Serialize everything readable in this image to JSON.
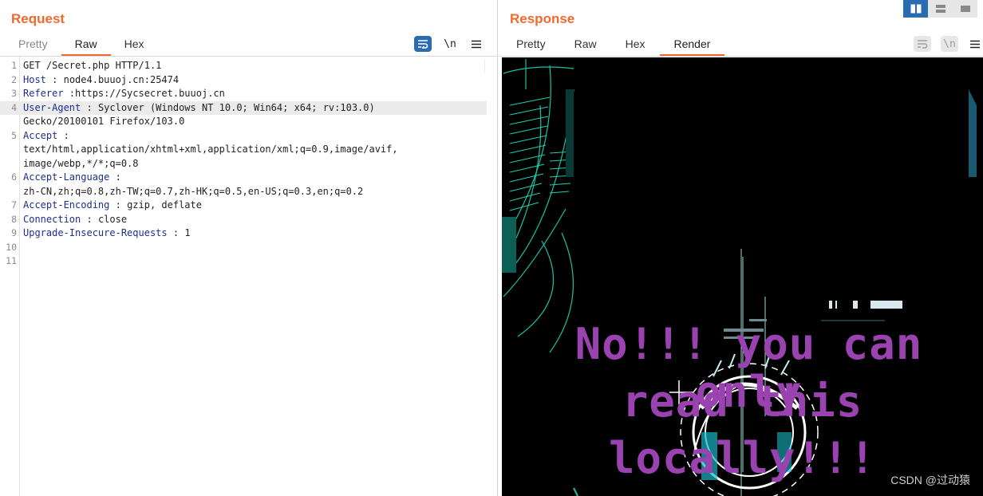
{
  "request": {
    "title": "Request",
    "tabs": [
      {
        "label": "Pretty"
      },
      {
        "label": "Raw"
      },
      {
        "label": "Hex"
      }
    ],
    "active_tab": "Raw",
    "toolbar": {
      "wrap_icon": "wrap-lines-icon",
      "newline_label": "\\n",
      "menu_icon": "hamburger-menu-icon"
    },
    "lines": [
      {
        "num": "1",
        "text": "GET /Secret.php  HTTP/1.1"
      },
      {
        "num": "2",
        "key": "Host",
        "sep": " : ",
        "val": "node4.buuoj.cn:25474"
      },
      {
        "num": "3",
        "key": "Referer",
        "sep": " :",
        "val": "https://Sycsecret.buuoj.cn"
      },
      {
        "num": "4",
        "key": "User-Agent",
        "sep": " : ",
        "val": "Syclover  (Windows  NT 10.0;  Win64;  x64;  rv:103.0)"
      },
      {
        "num": "",
        "text": "Gecko/20100101   Firefox/103.0"
      },
      {
        "num": "5",
        "key": "Accept",
        "sep": " :",
        "val": ""
      },
      {
        "num": "",
        "text": "text/html,application/xhtml+xml,application/xml;q=0.9,image/avif,"
      },
      {
        "num": "",
        "text": "image/webp,*/*;q=0.8"
      },
      {
        "num": "6",
        "key": "Accept-Language",
        "sep": "  :",
        "val": ""
      },
      {
        "num": "",
        "text": "zh-CN,zh;q=0.8,zh-TW;q=0.7,zh-HK;q=0.5,en-US;q=0.3,en;q=0.2"
      },
      {
        "num": "7",
        "key": "Accept-Encoding",
        "sep": " : ",
        "val": "gzip,  deflate"
      },
      {
        "num": "8",
        "key": "Connection",
        "sep": " : ",
        "val": "close"
      },
      {
        "num": "9",
        "key": "Upgrade-Insecure-Requests",
        "sep": "  : ",
        "val": "1"
      },
      {
        "num": "10",
        "text": ""
      },
      {
        "num": "11",
        "text": ""
      }
    ],
    "highlighted_line": 3
  },
  "response": {
    "title": "Response",
    "tabs": [
      {
        "label": "Pretty"
      },
      {
        "label": "Raw"
      },
      {
        "label": "Hex"
      },
      {
        "label": "Render"
      }
    ],
    "active_tab": "Render",
    "toolbar": {
      "wrap_icon": "wrap-lines-icon",
      "newline_label": "\\n",
      "menu_icon": "hamburger-menu-icon"
    },
    "render": {
      "message_lines": [
        "No!!! you can only",
        "read this",
        "locally!!!"
      ],
      "message_color": "#9a43b0",
      "background_color": "#000000"
    }
  },
  "layout_toggle": {
    "icons": [
      "side-by-side-layout-icon",
      "stacked-layout-icon",
      "single-pane-layout-icon"
    ],
    "selected": 0
  },
  "watermark": "CSDN @过动猿",
  "colors": {
    "accent": "#f0692f",
    "header_key": "#1d2f8c",
    "primary_button": "#2b6cb0"
  }
}
